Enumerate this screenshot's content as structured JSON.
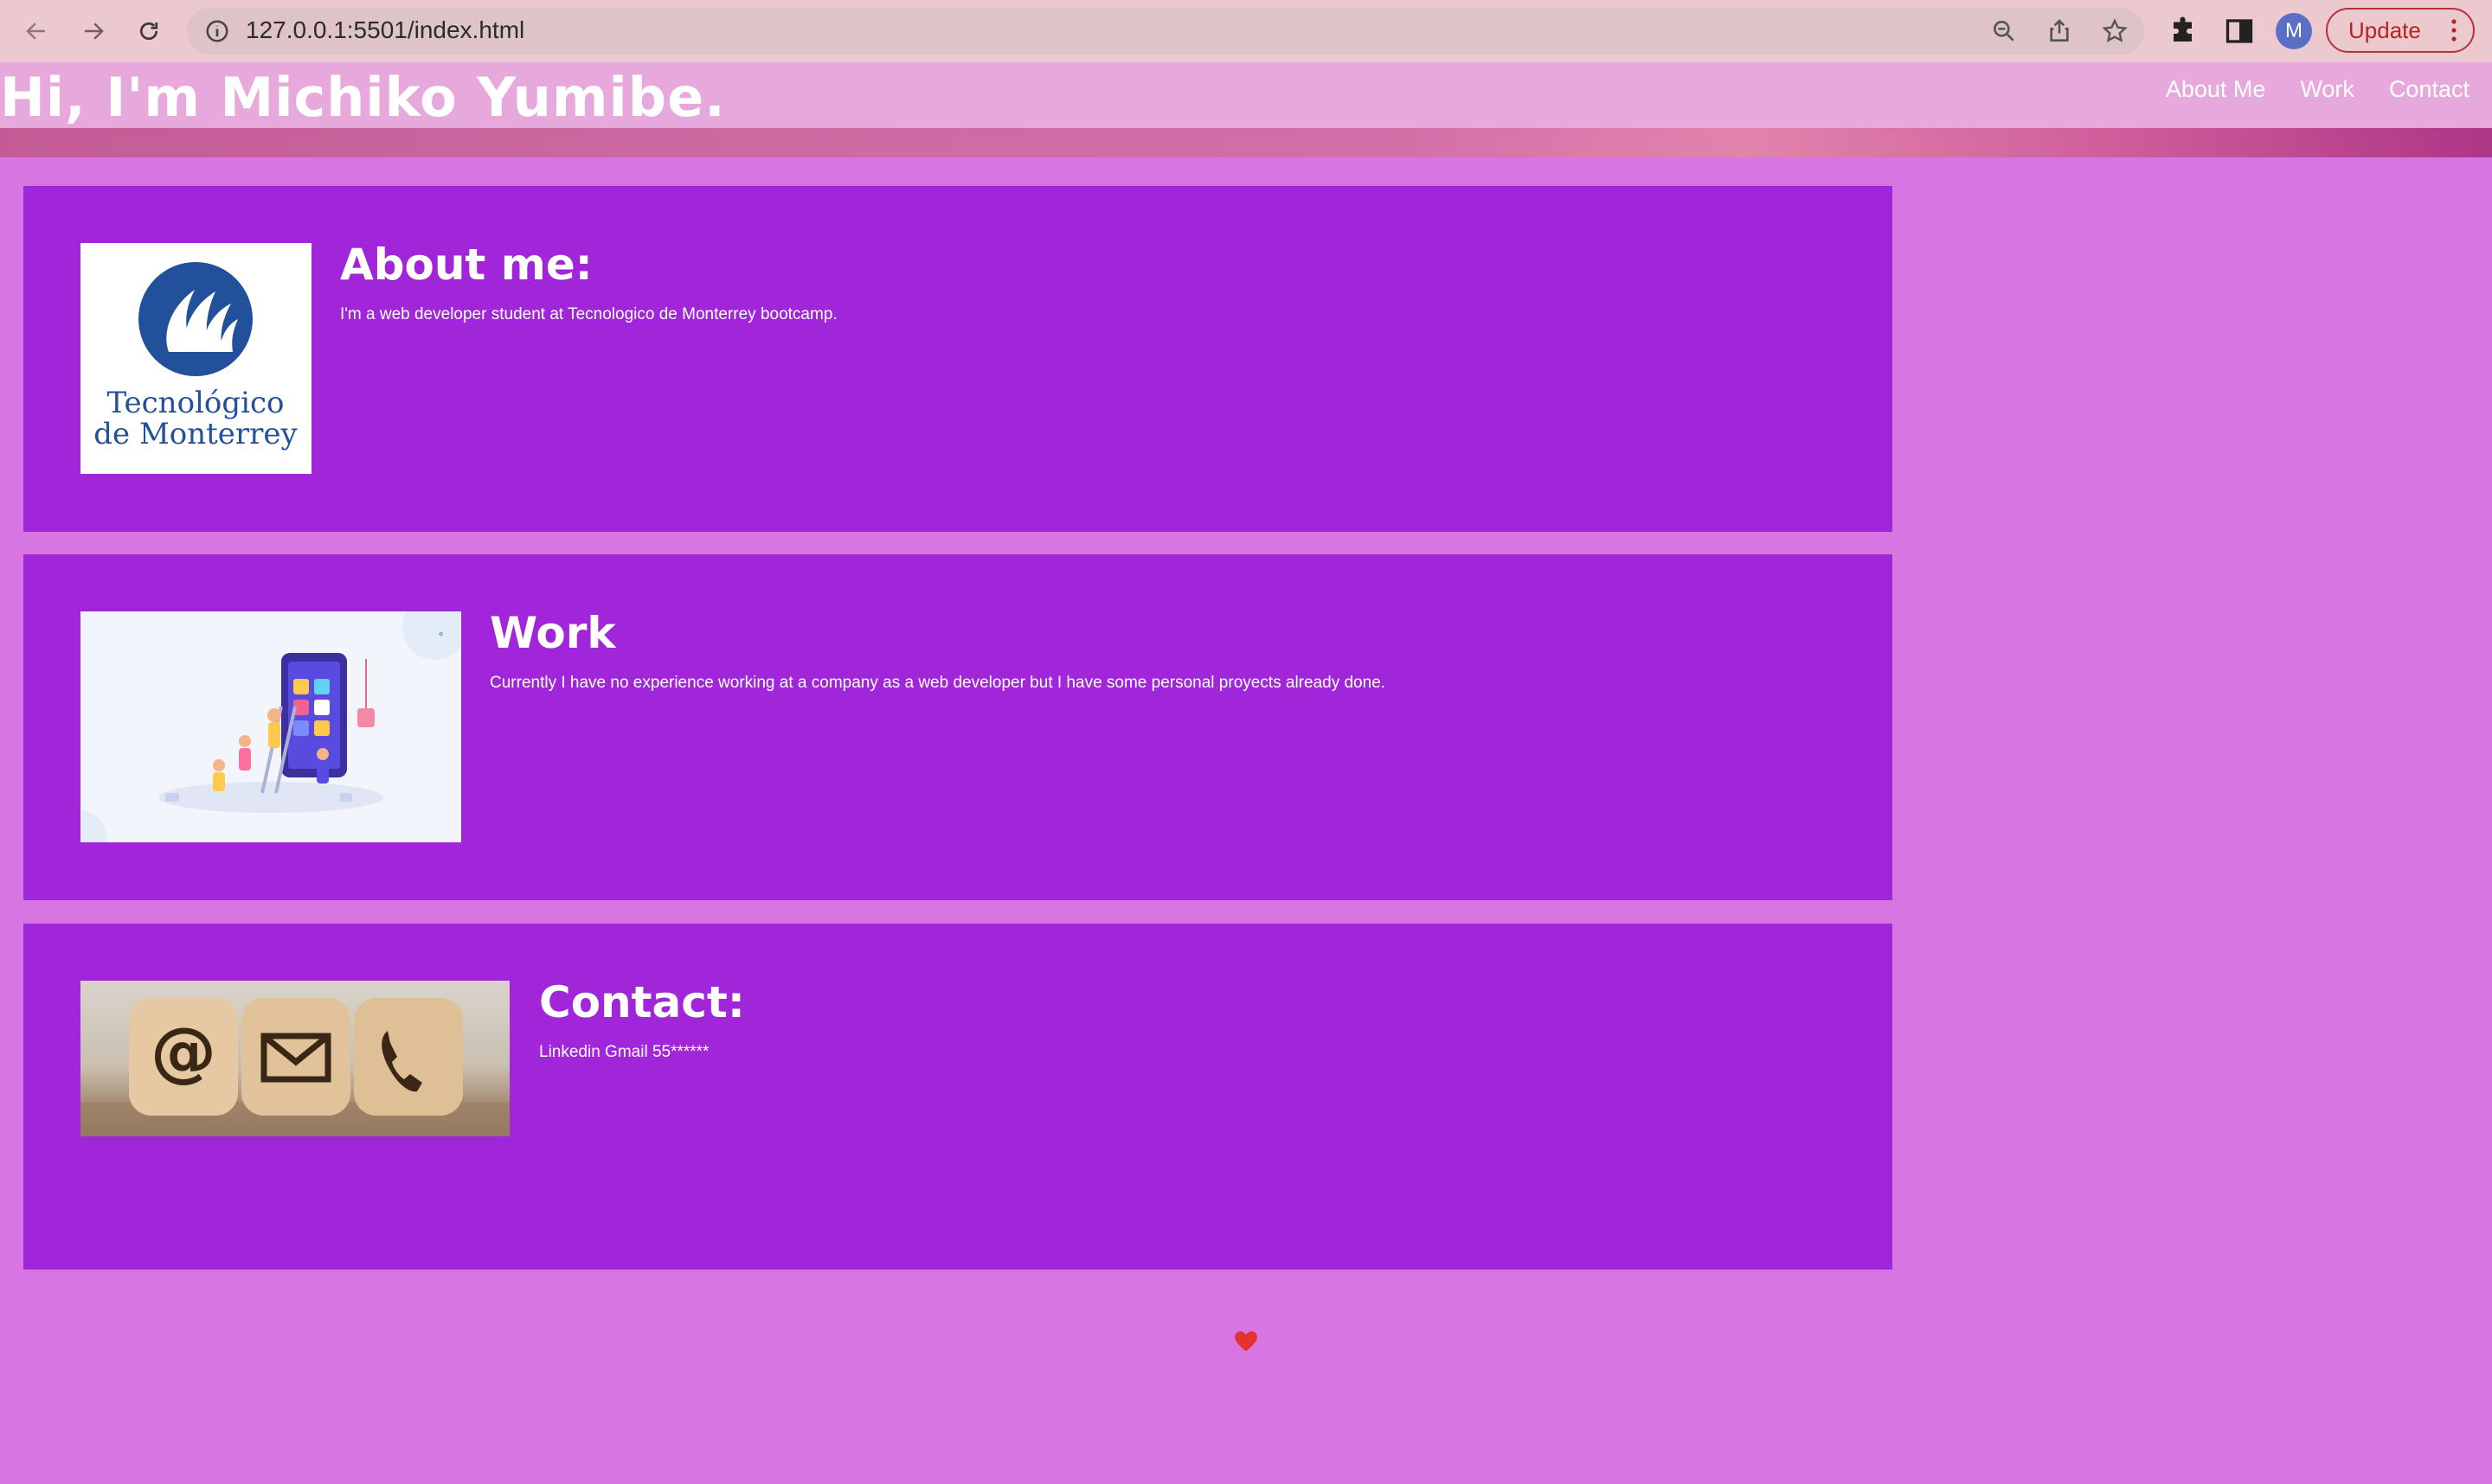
{
  "browser": {
    "url": "127.0.0.1:5501/index.html",
    "avatar_letter": "M",
    "update_label": "Update"
  },
  "header": {
    "title": "Hi, I'm Michiko Yumibe.",
    "nav": [
      "About Me",
      "Work",
      "Contact"
    ]
  },
  "sections": [
    {
      "heading": "About me:",
      "text": "I'm a web developer student at Tecnologico de Monterrey bootcamp.",
      "logo_line1": "Tecnológico",
      "logo_line2": "de Monterrey"
    },
    {
      "heading": "Work",
      "text": "Currently I have no experience working at a company as a web developer but I have some personal proyects already done."
    },
    {
      "heading": "Contact:",
      "text": "Linkedin Gmail 55******"
    }
  ],
  "footer": {
    "icon": "heart-icon"
  },
  "colors": {
    "page_bg": "#d776e3",
    "card_bg": "#a126d9",
    "header_bg": "#e7a9dc",
    "chrome_bg": "#ecc8cf",
    "update_red": "#b3261e"
  }
}
